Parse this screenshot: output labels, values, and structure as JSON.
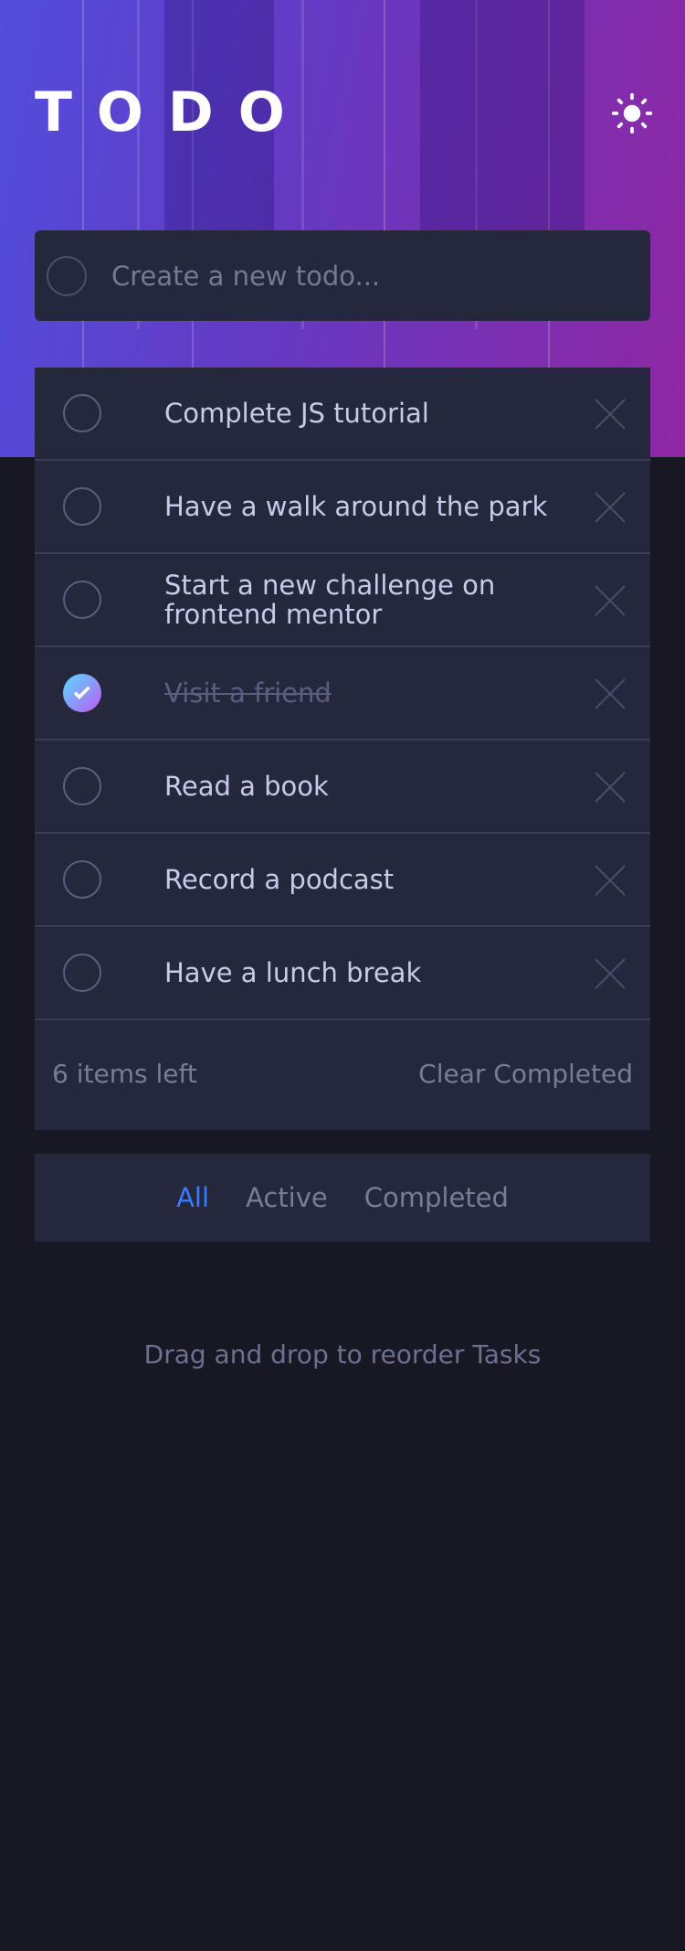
{
  "header": {
    "title": "TODO"
  },
  "new_todo": {
    "placeholder": "Create a new todo..."
  },
  "todos": [
    {
      "text": "Complete JS tutorial",
      "completed": false
    },
    {
      "text": "Have a walk around the park",
      "completed": false
    },
    {
      "text": "Start a new challenge on frontend mentor",
      "completed": false
    },
    {
      "text": "Visit a friend",
      "completed": true
    },
    {
      "text": "Read a book",
      "completed": false
    },
    {
      "text": "Record a podcast",
      "completed": false
    },
    {
      "text": "Have a lunch break",
      "completed": false
    }
  ],
  "footer": {
    "items_left": "6 items left",
    "clear_label": "Clear Completed"
  },
  "filters": {
    "all": "All",
    "active": "Active",
    "completed": "Completed",
    "selected": "all"
  },
  "hint": "Drag and drop to reorder Tasks",
  "colors": {
    "background": "#171823",
    "card": "#25273D",
    "accent": "#3A7CFD",
    "check_gradient_start": "#55DDFF",
    "check_gradient_end": "#C058F3"
  },
  "icons": {
    "theme_toggle": "sun-icon",
    "delete": "cross-icon",
    "check": "check-icon"
  }
}
